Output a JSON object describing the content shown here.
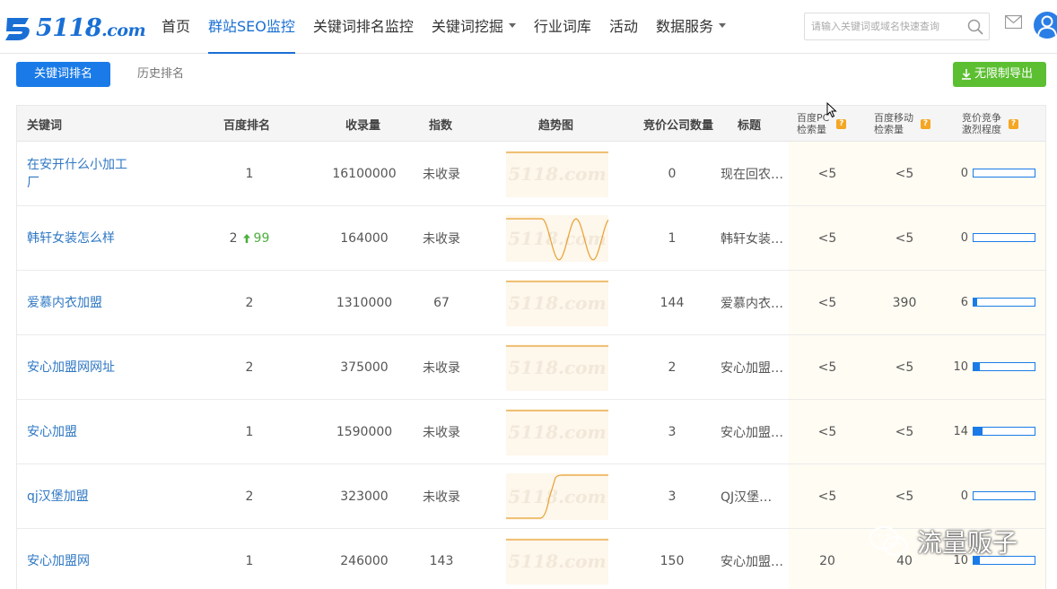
{
  "header": {
    "logo_text": "5118",
    "logo_suffix": ".com",
    "nav": [
      {
        "label": "首页",
        "active": false,
        "dropdown": false
      },
      {
        "label": "群站SEO监控",
        "active": true,
        "dropdown": false
      },
      {
        "label": "关键词排名监控",
        "active": false,
        "dropdown": false
      },
      {
        "label": "关键词挖掘",
        "active": false,
        "dropdown": true
      },
      {
        "label": "行业词库",
        "active": false,
        "dropdown": false
      },
      {
        "label": "活动",
        "active": false,
        "dropdown": false
      },
      {
        "label": "数据服务",
        "active": false,
        "dropdown": true
      }
    ],
    "search_placeholder": "请输入关键词或域名快速查询"
  },
  "toolbar": {
    "tab_active": "关键词排名",
    "tab_history": "历史排名",
    "export_label": "无限制导出"
  },
  "table": {
    "headers": {
      "keyword": "关键词",
      "rank": "百度排名",
      "indexed": "收录量",
      "index": "指数",
      "trend": "趋势图",
      "bidders": "竞价公司数量",
      "title": "标题",
      "pc_volume_1": "百度PC",
      "pc_volume_2": "检索量",
      "mobile_volume_1": "百度移动",
      "mobile_volume_2": "检索量",
      "competition_1": "竞价竞争",
      "competition_2": "激烈程度",
      "help": "?"
    },
    "rows": [
      {
        "keyword": "在安开什么小加工厂",
        "rank": "1",
        "rank_change": "",
        "indexed": "16100000",
        "index": "未收录",
        "trend": "flat",
        "bidders": "0",
        "title": "现在回农…",
        "pc": "<5",
        "mobile": "<5",
        "competition": "0",
        "competition_level": 0
      },
      {
        "keyword": "韩轩女装怎么样",
        "rank": "2",
        "rank_change": "99",
        "indexed": "164000",
        "index": "未收录",
        "trend": "wave",
        "bidders": "1",
        "title": "韩轩女装…",
        "pc": "<5",
        "mobile": "<5",
        "competition": "0",
        "competition_level": 0
      },
      {
        "keyword": "爱慕内衣加盟",
        "rank": "2",
        "rank_change": "",
        "indexed": "1310000",
        "index": "67",
        "trend": "flat",
        "bidders": "144",
        "title": "爱慕内衣…",
        "pc": "<5",
        "mobile": "390",
        "competition": "6",
        "competition_level": 0.06
      },
      {
        "keyword": "安心加盟网网址",
        "rank": "2",
        "rank_change": "",
        "indexed": "375000",
        "index": "未收录",
        "trend": "flat",
        "bidders": "2",
        "title": "安心加盟…",
        "pc": "<5",
        "mobile": "<5",
        "competition": "10",
        "competition_level": 0.1
      },
      {
        "keyword": "安心加盟",
        "rank": "1",
        "rank_change": "",
        "indexed": "1590000",
        "index": "未收录",
        "trend": "flat",
        "bidders": "3",
        "title": "安心加盟…",
        "pc": "<5",
        "mobile": "<5",
        "competition": "14",
        "competition_level": 0.14
      },
      {
        "keyword": "qj汉堡加盟",
        "rank": "2",
        "rank_change": "",
        "indexed": "323000",
        "index": "未收录",
        "trend": "step",
        "bidders": "3",
        "title": "QJ汉堡…",
        "pc": "<5",
        "mobile": "<5",
        "competition": "0",
        "competition_level": 0
      },
      {
        "keyword": "安心加盟网",
        "rank": "1",
        "rank_change": "",
        "indexed": "246000",
        "index": "143",
        "trend": "flat",
        "bidders": "150",
        "title": "安心加盟…",
        "pc": "20",
        "mobile": "40",
        "competition": "10",
        "competition_level": 0.1
      }
    ]
  },
  "trend_watermark": "5118.com",
  "overlay": {
    "wechat_label": "流量贩子"
  },
  "colors": {
    "accent": "#1a7be8",
    "green": "#5cbf32",
    "trend_line": "#e8a030"
  }
}
